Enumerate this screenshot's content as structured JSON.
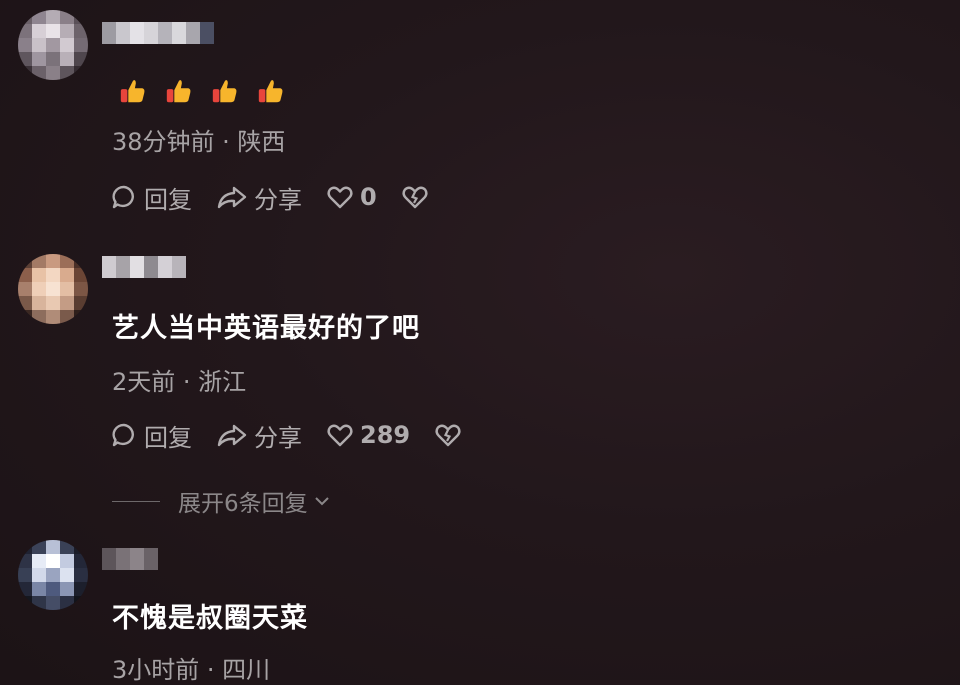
{
  "comments": [
    {
      "text": "",
      "emoji": [
        "thumbs-up",
        "thumbs-up",
        "thumbs-up",
        "thumbs-up"
      ],
      "meta": "38分钟前 · 陕西",
      "actions": {
        "reply": "回复",
        "share": "分享",
        "likes": "0"
      }
    },
    {
      "text": "艺人当中英语最好的了吧",
      "meta": "2天前 · 浙江",
      "actions": {
        "reply": "回复",
        "share": "分享",
        "likes": "289"
      },
      "expand": "展开6条回复"
    },
    {
      "text": "不愧是叔圈天菜",
      "meta": "3小时前 · 四川"
    }
  ],
  "icons": {
    "reply": "speech-bubble-icon",
    "share": "share-arrow-icon",
    "like": "heart-icon",
    "dislike": "broken-heart-icon",
    "expand": "chevron-down-icon"
  },
  "colors": {
    "background": "#22171b",
    "text": "#ffffff",
    "meta": "#a7a3a5",
    "action": "#b0acae"
  }
}
